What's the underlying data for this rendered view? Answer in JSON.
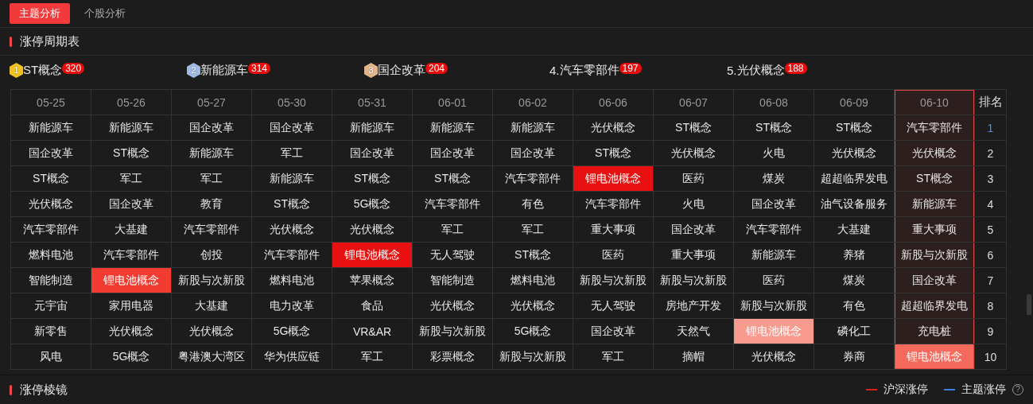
{
  "tabs": [
    {
      "label": "主题分析",
      "selected": true
    },
    {
      "label": "个股分析",
      "selected": false
    }
  ],
  "cycle_section": {
    "title": "涨停周期表"
  },
  "top_themes": [
    {
      "kind": "medal",
      "rank": "1",
      "label": "ST概念",
      "count": "320",
      "color": "#f2c224"
    },
    {
      "kind": "medal",
      "rank": "2",
      "label": "新能源车",
      "count": "314",
      "color": "#9fbbe3"
    },
    {
      "kind": "medal",
      "rank": "3",
      "label": "国企改革",
      "count": "204",
      "color": "#e3b58c"
    },
    {
      "kind": "plain",
      "rank": "4.",
      "label": "汽车零部件",
      "count": "197"
    },
    {
      "kind": "plain",
      "rank": "5.",
      "label": "光伏概念",
      "count": "188"
    }
  ],
  "table": {
    "columns": [
      {
        "date": "05-25",
        "selected": false
      },
      {
        "date": "05-26",
        "selected": false
      },
      {
        "date": "05-27",
        "selected": false
      },
      {
        "date": "05-30",
        "selected": false
      },
      {
        "date": "05-31",
        "selected": false
      },
      {
        "date": "06-01",
        "selected": false
      },
      {
        "date": "06-02",
        "selected": false
      },
      {
        "date": "06-06",
        "selected": false
      },
      {
        "date": "06-07",
        "selected": false
      },
      {
        "date": "06-08",
        "selected": false
      },
      {
        "date": "06-09",
        "selected": false
      },
      {
        "date": "06-10",
        "selected": true
      }
    ],
    "rank_heading": "排名",
    "rows": [
      {
        "rank": "1",
        "selected": true,
        "cells": [
          "新能源车",
          "新能源车",
          "国企改革",
          "国企改革",
          "新能源车",
          "新能源车",
          "新能源车",
          "光伏概念",
          "ST概念",
          "ST概念",
          "ST概念",
          "汽车零部件"
        ]
      },
      {
        "rank": "2",
        "selected": false,
        "cells": [
          "国企改革",
          "ST概念",
          "新能源车",
          "军工",
          "国企改革",
          "国企改革",
          "国企改革",
          "ST概念",
          "光伏概念",
          "火电",
          "光伏概念",
          "光伏概念"
        ]
      },
      {
        "rank": "3",
        "selected": false,
        "cells": [
          "ST概念",
          "军工",
          "军工",
          "新能源车",
          "ST概念",
          "ST概念",
          "汽车零部件",
          {
            "text": "锂电池概念",
            "color": "#e81010"
          },
          "医药",
          "煤炭",
          "超超临界发电",
          "ST概念"
        ]
      },
      {
        "rank": "4",
        "selected": false,
        "cells": [
          "光伏概念",
          "国企改革",
          "教育",
          "ST概念",
          "5G概念",
          "汽车零部件",
          "有色",
          "汽车零部件",
          "火电",
          "国企改革",
          "油气设备服务",
          "新能源车"
        ]
      },
      {
        "rank": "5",
        "selected": false,
        "cells": [
          "汽车零部件",
          "大基建",
          "汽车零部件",
          "光伏概念",
          "光伏概念",
          "军工",
          "军工",
          "重大事项",
          "国企改革",
          "汽车零部件",
          "大基建",
          "重大事项"
        ]
      },
      {
        "rank": "6",
        "selected": false,
        "cells": [
          "燃料电池",
          "汽车零部件",
          "创投",
          "汽车零部件",
          {
            "text": "锂电池概念",
            "color": "#e81010"
          },
          "无人驾驶",
          "ST概念",
          "医药",
          "重大事项",
          "新能源车",
          "养猪",
          "新股与次新股"
        ]
      },
      {
        "rank": "7",
        "selected": false,
        "cells": [
          "智能制造",
          {
            "text": "锂电池概念",
            "color": "#f23c32"
          },
          "新股与次新股",
          "燃料电池",
          "苹果概念",
          "智能制造",
          "燃料电池",
          "新股与次新股",
          "新股与次新股",
          "医药",
          "煤炭",
          "国企改革"
        ]
      },
      {
        "rank": "8",
        "selected": false,
        "cells": [
          "元宇宙",
          "家用电器",
          "大基建",
          "电力改革",
          "食品",
          "光伏概念",
          "光伏概念",
          "无人驾驶",
          "房地产开发",
          "新股与次新股",
          "有色",
          "超超临界发电"
        ]
      },
      {
        "rank": "9",
        "selected": false,
        "cells": [
          "新零售",
          "光伏概念",
          "光伏概念",
          "5G概念",
          "VR&AR",
          "新股与次新股",
          "5G概念",
          "国企改革",
          "天然气",
          {
            "text": "锂电池概念",
            "color": "#f89a8e"
          },
          "磷化工",
          "充电桩"
        ]
      },
      {
        "rank": "10",
        "selected": false,
        "cells": [
          "风电",
          "5G概念",
          "粤港澳大湾区",
          "华为供应链",
          "军工",
          "彩票概念",
          "新股与次新股",
          "军工",
          "摘帽",
          "光伏概念",
          "券商",
          {
            "text": "锂电池概念",
            "color": "#f56a5c"
          }
        ]
      }
    ]
  },
  "prism_section": {
    "title": "涨停棱镜",
    "legend": [
      {
        "label": "沪深涨停",
        "color": "#e02020"
      },
      {
        "label": "主题涨停",
        "color": "#3a7ee8"
      }
    ],
    "help": "?"
  }
}
